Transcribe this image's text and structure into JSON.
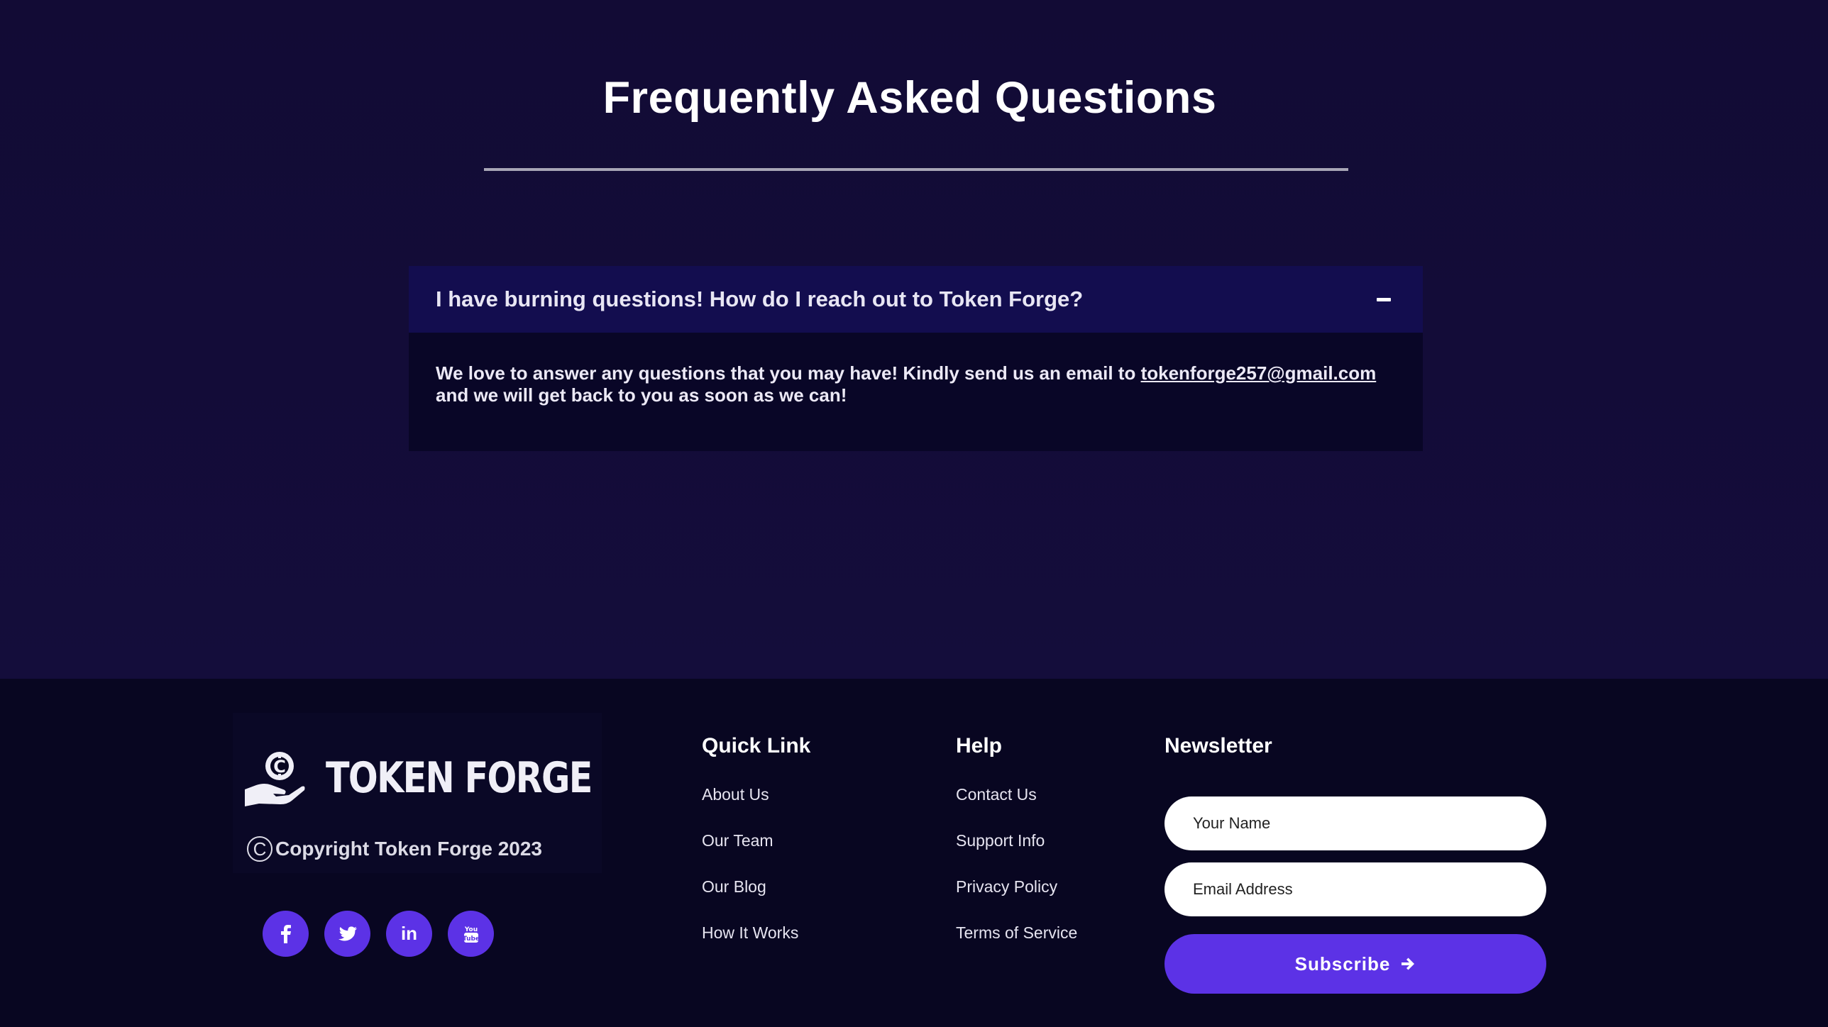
{
  "faq": {
    "title": "Frequently Asked Questions",
    "items": [
      {
        "question": "I have burning questions! How do I reach out to Token Forge?",
        "toggle_icon": "minus-icon",
        "answer_prefix": "We love to answer any questions that you may have! Kindly send us an email to ",
        "email": "tokenforge257@gmail.com",
        "answer_suffix": "and we will get back to you as soon as we can!"
      }
    ]
  },
  "footer": {
    "brand": {
      "logo_icon": "hand-coin-icon",
      "name": "TOKEN FORGE",
      "copyright_symbol": "C",
      "copyright": "Copyright Token Forge 2023"
    },
    "socials": [
      {
        "icon": "facebook-icon",
        "label": "f"
      },
      {
        "icon": "twitter-icon",
        "label": ""
      },
      {
        "icon": "linkedin-icon",
        "label": "in"
      },
      {
        "icon": "youtube-icon",
        "label": ""
      }
    ],
    "quick_link": {
      "heading": "Quick Link",
      "items": [
        "About Us",
        "Our Team",
        "Our Blog",
        "How It Works"
      ]
    },
    "help": {
      "heading": "Help",
      "items": [
        "Contact Us",
        "Support Info",
        "Privacy Policy",
        "Terms of Service"
      ]
    },
    "newsletter": {
      "heading": "Newsletter",
      "name_placeholder": "Your Name",
      "email_placeholder": "Email Address",
      "subscribe_label": "Subscribe",
      "subscribe_icon": "arrow-right-icon"
    }
  },
  "colors": {
    "background": "#120b35",
    "footer_background": "#080621",
    "accent": "#5c32e6",
    "faq_question_bar": "#130d4f",
    "faq_answer_panel": "#090627"
  }
}
